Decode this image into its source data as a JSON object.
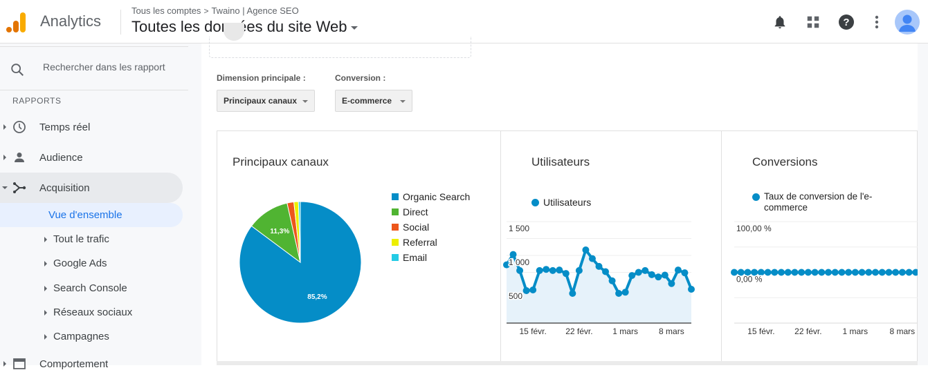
{
  "header": {
    "app_name": "Analytics",
    "breadcrumb": {
      "account": "Tous les comptes",
      "separator": ">",
      "property": "Twaino | Agence SEO"
    },
    "view_title": "Toutes les données du site Web",
    "icons": [
      "notifications-icon",
      "apps-icon",
      "help-icon",
      "more-vert-icon",
      "account-avatar"
    ]
  },
  "sidebar": {
    "search_placeholder": "Rechercher dans les rapport",
    "section_label": "RAPPORTS",
    "items": [
      {
        "label": "Temps réel",
        "icon": "clock-icon",
        "expanded": false
      },
      {
        "label": "Audience",
        "icon": "person-icon",
        "expanded": false
      },
      {
        "label": "Acquisition",
        "icon": "acquisition-icon",
        "expanded": true
      },
      {
        "label": "Comportement",
        "icon": "behavior-icon",
        "expanded": false
      }
    ],
    "acquisition_sub": [
      {
        "label": "Vue d'ensemble",
        "selected": true
      },
      {
        "label": "Tout le trafic"
      },
      {
        "label": "Google Ads"
      },
      {
        "label": "Search Console"
      },
      {
        "label": "Réseaux sociaux"
      },
      {
        "label": "Campagnes"
      }
    ]
  },
  "controls": {
    "dimension_label": "Dimension principale :",
    "dimension_value": "Principaux canaux",
    "conversion_label": "Conversion :",
    "conversion_value": "E-commerce"
  },
  "panels": {
    "channels_title": "Principaux canaux",
    "users_title": "Utilisateurs",
    "conversions_title": "Conversions"
  },
  "colors": {
    "organic": "#058dc7",
    "direct": "#50b432",
    "social": "#ed561b",
    "referral": "#edef00",
    "email": "#24cbe5",
    "line": "#058dc7",
    "area": "#e6f2fa"
  },
  "chart_data": [
    {
      "type": "pie",
      "title": "Principaux canaux",
      "legend_position": "right",
      "slices": [
        {
          "label": "Organic Search",
          "value": 85.2,
          "data_label": "85,2%"
        },
        {
          "label": "Direct",
          "value": 11.3,
          "data_label": "11,3%"
        },
        {
          "label": "Social",
          "value": 1.8,
          "data_label": ""
        },
        {
          "label": "Referral",
          "value": 1.2,
          "data_label": ""
        },
        {
          "label": "Email",
          "value": 0.5,
          "data_label": ""
        }
      ]
    },
    {
      "type": "area",
      "title": "Utilisateurs",
      "legend": [
        "Utilisateurs"
      ],
      "ylim": [
        0,
        1500
      ],
      "yticks": [
        500,
        1000,
        1500
      ],
      "ytick_labels": [
        "500",
        "1 000",
        "1 500"
      ],
      "xtick_labels": [
        "15 févr.",
        "22 févr.",
        "1 mars",
        "8 mars"
      ],
      "xtick_indices": [
        4,
        11,
        18,
        25
      ],
      "grid": true,
      "values": [
        861,
        1014,
        777,
        480,
        490,
        777,
        794,
        777,
        784,
        733,
        439,
        777,
        1081,
        953,
        838,
        760,
        625,
        439,
        456,
        703,
        750,
        777,
        716,
        682,
        709,
        584,
        784,
        743,
        500
      ]
    },
    {
      "type": "line",
      "title": "Conversions",
      "legend": [
        "Taux de conversion de l'e-commerce"
      ],
      "ylim": [
        -100,
        100
      ],
      "yticks": [
        0,
        100
      ],
      "ytick_labels": [
        "0,00 %",
        "100,00 %"
      ],
      "xtick_labels": [
        "15 févr.",
        "22 févr.",
        "1 mars",
        "8 mars"
      ],
      "xtick_indices": [
        4,
        11,
        18,
        25
      ],
      "grid": true,
      "values": [
        0,
        0,
        0,
        0,
        0,
        0,
        0,
        0,
        0,
        0,
        0,
        0,
        0,
        0,
        0,
        0,
        0,
        0,
        0,
        0,
        0,
        0,
        0,
        0,
        0,
        0,
        0,
        0,
        0
      ]
    }
  ]
}
